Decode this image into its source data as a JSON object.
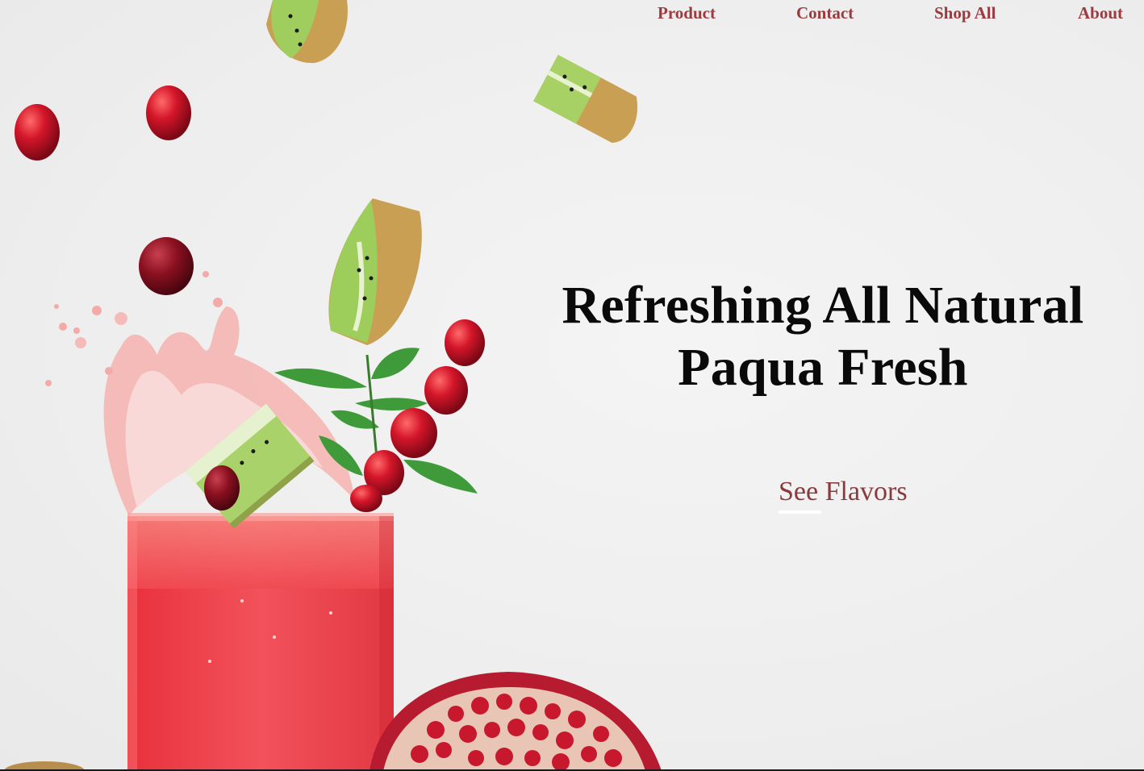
{
  "nav": {
    "items": [
      {
        "label": "Product"
      },
      {
        "label": "Contact"
      },
      {
        "label": "Shop All"
      },
      {
        "label": "About"
      }
    ]
  },
  "hero": {
    "title_line1": "Refreshing All Natural",
    "title_line2": "Paqua Fresh",
    "cta_label": "See Flavors"
  },
  "colors": {
    "nav_link": "#9a3b3f",
    "cta": "#8a3a3d",
    "title": "#0a0a0a",
    "juice": "#ee3f4a",
    "background": "#efefef"
  }
}
